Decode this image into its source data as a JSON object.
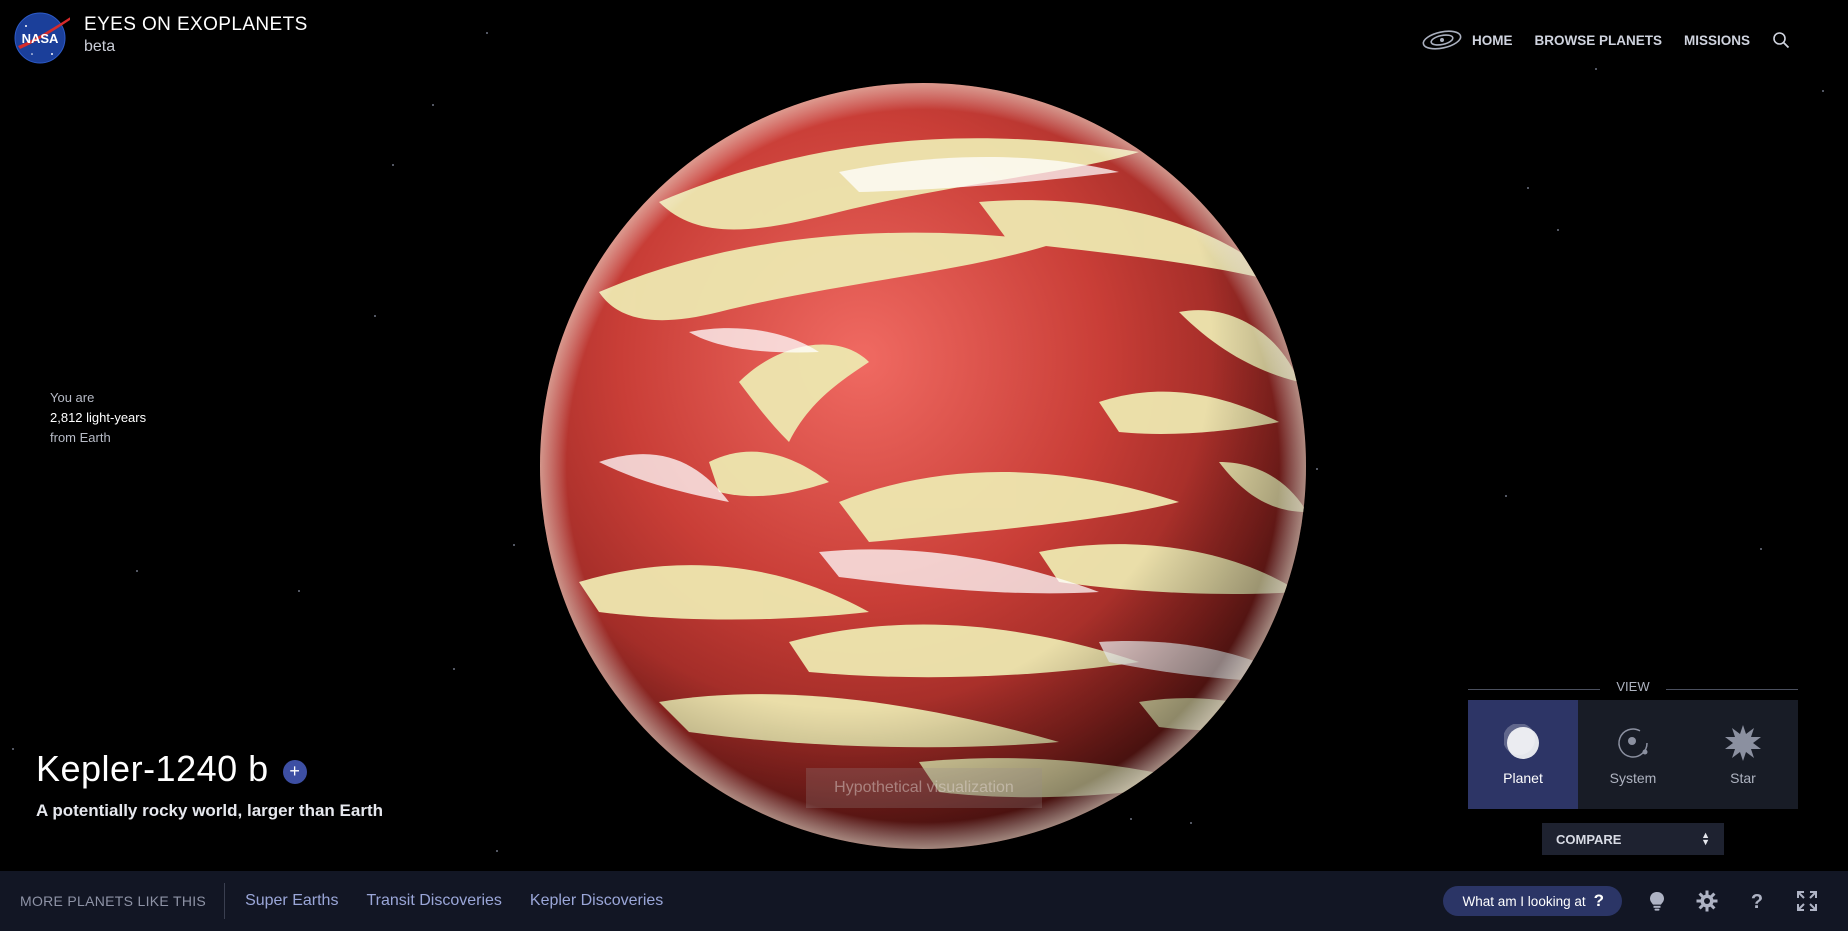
{
  "header": {
    "title": "EYES ON EXOPLANETS",
    "subtitle": "beta",
    "logo_text": "NASA",
    "nav": [
      {
        "label": "HOME",
        "icon": "galaxy-icon"
      },
      {
        "label": "BROWSE PLANETS"
      },
      {
        "label": "MISSIONS"
      }
    ],
    "search_icon": "search-icon"
  },
  "distance": {
    "line1": "You are",
    "line2": "2,812 light-years",
    "line3": "from Earth"
  },
  "planet": {
    "name": "Kepler-1240 b",
    "add_label": "+",
    "description": "A potentially rocky world, larger than Earth",
    "visualization_note": "Hypothetical visualization"
  },
  "view": {
    "label": "VIEW",
    "options": [
      {
        "label": "Planet",
        "icon": "planet-icon",
        "active": true
      },
      {
        "label": "System",
        "icon": "system-icon",
        "active": false
      },
      {
        "label": "Star",
        "icon": "star-icon",
        "active": false
      }
    ]
  },
  "compare": {
    "label": "COMPARE"
  },
  "bottom": {
    "more_label": "MORE PLANETS LIKE THIS",
    "links": [
      "Super Earths",
      "Transit Discoveries",
      "Kepler Discoveries"
    ],
    "what_label": "What am I looking at",
    "what_q": "?",
    "icons": [
      "lightbulb-icon",
      "gear-icon",
      "help-icon",
      "fullscreen-icon"
    ]
  },
  "colors": {
    "accent": "#2d3566",
    "bottom_bar": "#121624",
    "planet_red": "#c2413a",
    "planet_cloud": "#eee8b0"
  }
}
